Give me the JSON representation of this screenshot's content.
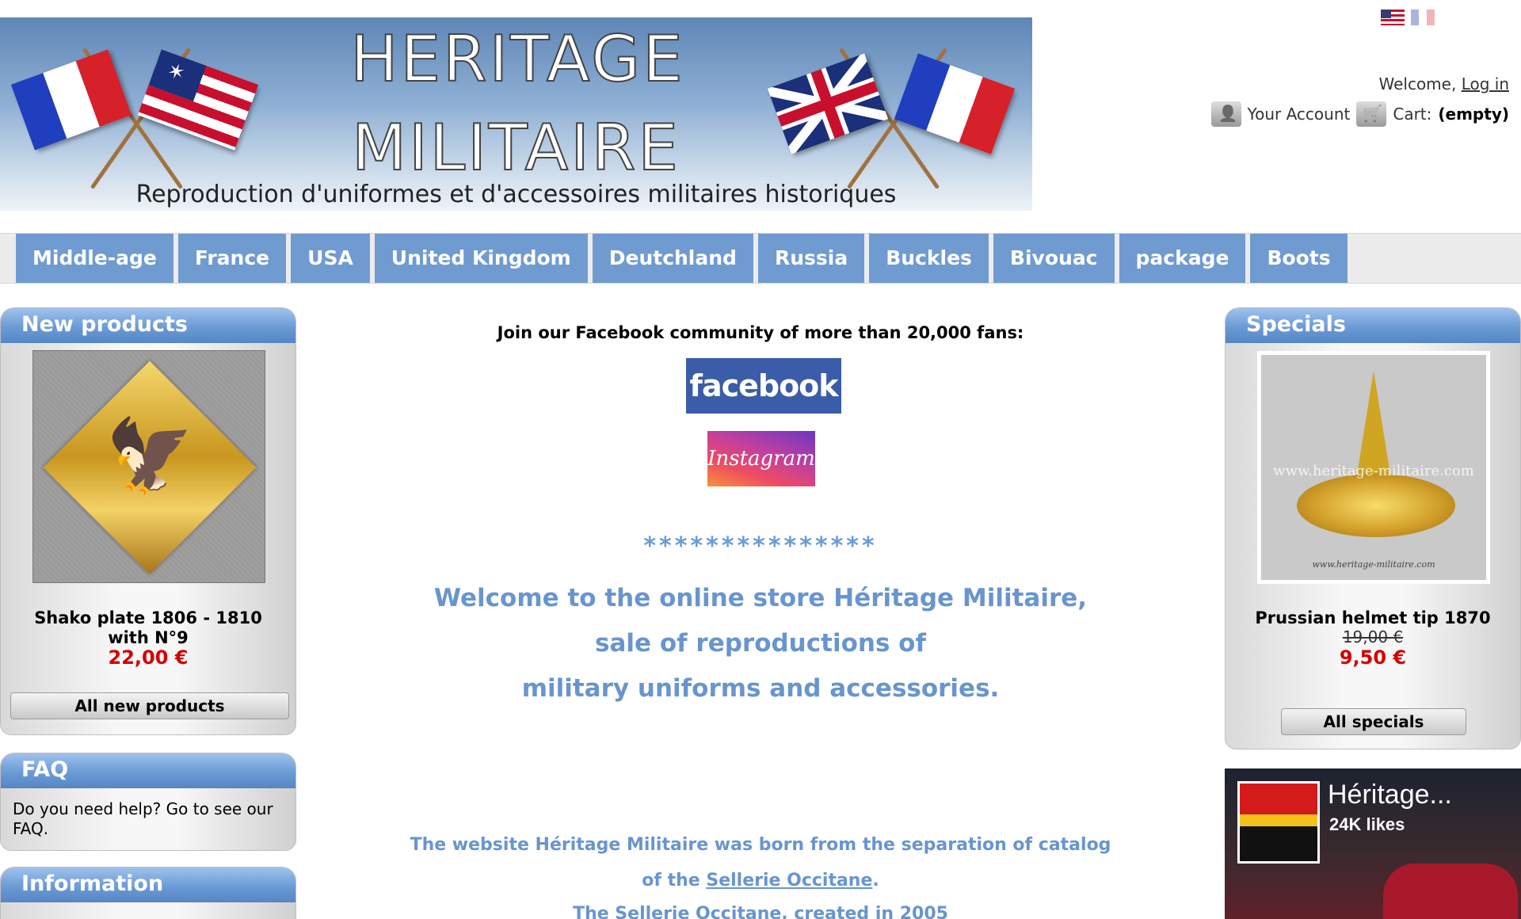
{
  "banner": {
    "title_line1": "HERITAGE",
    "title_line2": "MILITAIRE",
    "subtitle": "Reproduction d'uniformes et d'accessoires militaires historiques"
  },
  "user": {
    "welcome": "Welcome,",
    "login": "Log in",
    "account": "Your Account",
    "cart_label": "Cart:",
    "cart_value": "(empty)"
  },
  "nav": [
    "Middle-age",
    "France",
    "USA",
    "United Kingdom",
    "Deutchland",
    "Russia",
    "Buckles",
    "Bivouac",
    "package",
    "Boots"
  ],
  "new_products": {
    "title": "New products",
    "product_name": "Shako plate 1806 - 1810 with N°9",
    "price": "22,00 €",
    "button": "All new products"
  },
  "faq": {
    "title": "FAQ",
    "text": "Do you need help? Go to see our FAQ."
  },
  "information": {
    "title": "Information"
  },
  "specials": {
    "title": "Specials",
    "product_name": "Prussian helmet tip 1870",
    "old_price": "19,00 €",
    "price": "9,50 €",
    "button": "All specials",
    "watermark": "www.heritage-militaire.com",
    "watermark_small": "www.heritage-militaire.com"
  },
  "center": {
    "facebook_invite": "Join our Facebook community of more than 20,000 fans:",
    "facebook_button": "facebook",
    "instagram_button": "Instagram",
    "stars": "***************",
    "welcome_line1": "Welcome to the online store Héritage Militaire,",
    "welcome_line2": "sale of reproductions of",
    "welcome_line3": "military uniforms and accessories.",
    "about_line1": "The website Héritage Militaire was born from the separation of catalog",
    "about_line2_pre": "of the",
    "about_line2_link": "Sellerie Occitane",
    "about_line2_post": ".",
    "about_line3": "The Sellerie Occitane, created in 2005"
  },
  "fb_widget": {
    "name": "Héritage...",
    "likes": "24K likes"
  }
}
